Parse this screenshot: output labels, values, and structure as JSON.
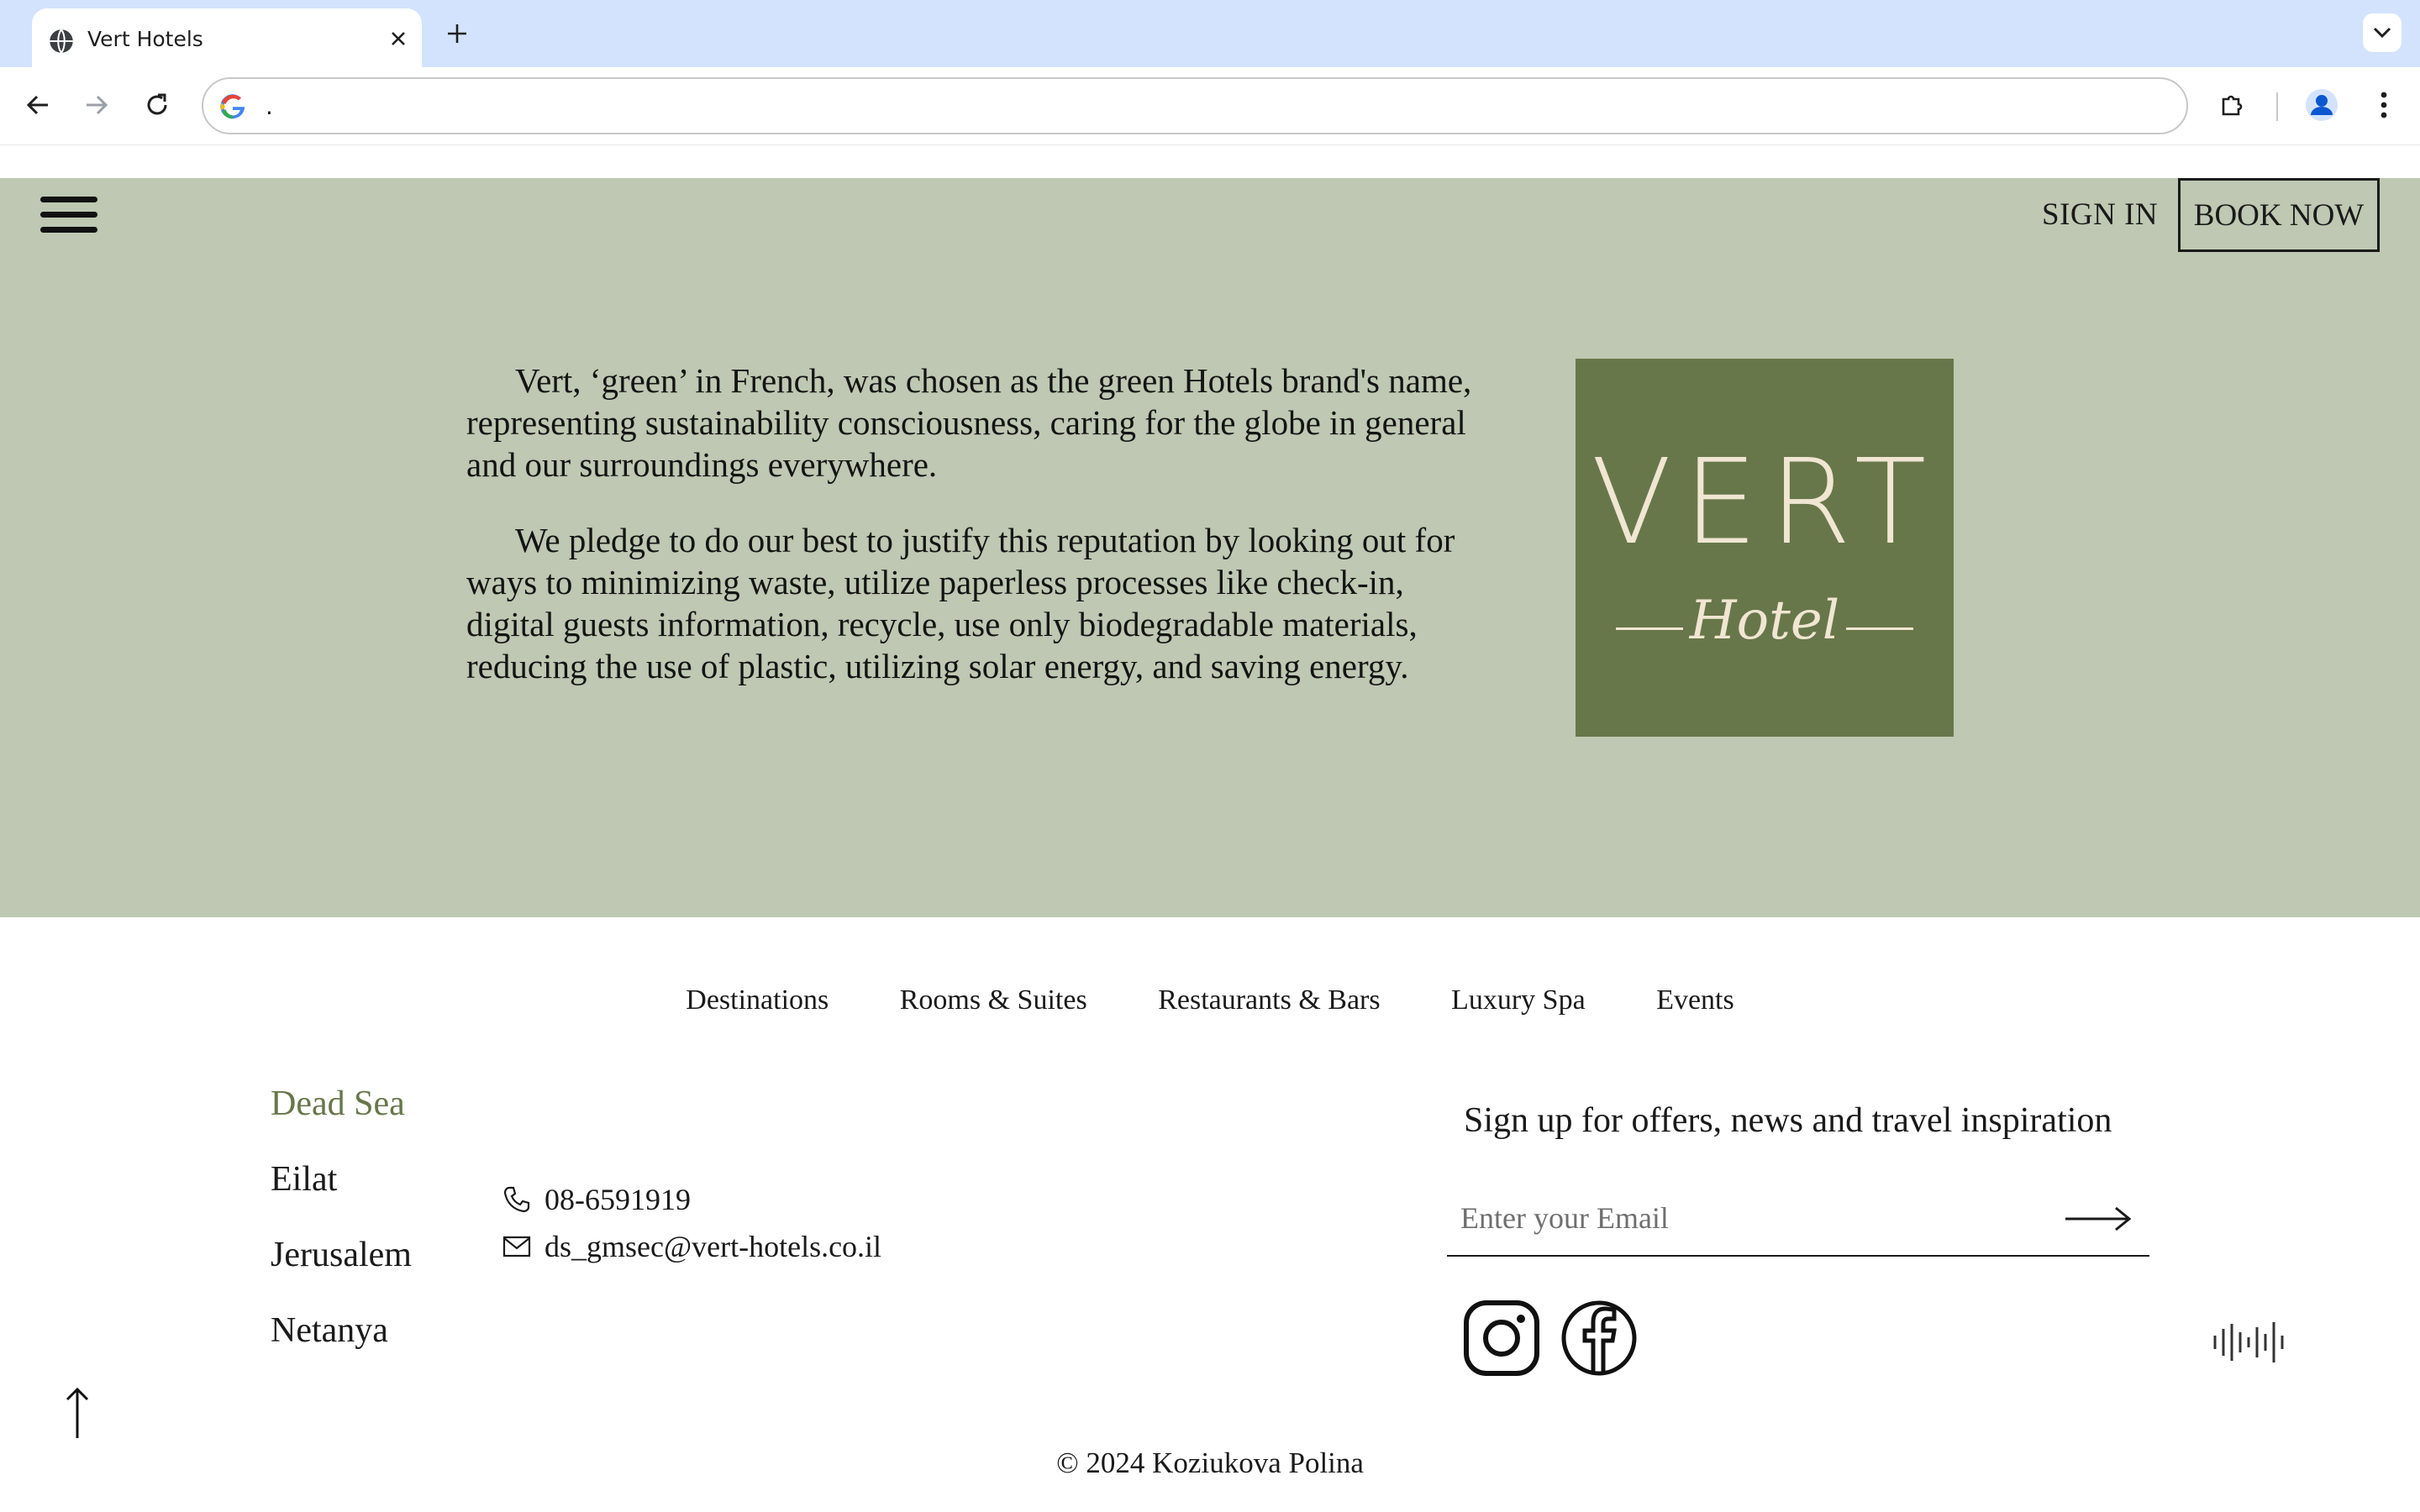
{
  "browser": {
    "tab_title": "Vert Hotels",
    "address_text": ".",
    "icons": {
      "favicon": "globe-icon",
      "close": "close-icon",
      "new_tab": "plus-icon",
      "tab_list": "chevron-down-icon",
      "back": "back-arrow-icon",
      "forward": "forward-arrow-icon",
      "reload": "reload-icon",
      "google": "google-g-icon",
      "extensions": "puzzle-icon",
      "profile": "profile-avatar-icon",
      "menu": "kebab-menu-icon"
    }
  },
  "header": {
    "menu_icon": "hamburger-icon",
    "sign_in_label": "SIGN IN",
    "book_now_label": "BOOK NOW"
  },
  "hero": {
    "paragraphs": [
      "Vert, ‘green’ in French, was chosen as the green Hotels brand's name, representing sustainability consciousness, caring for the globe in general and our surroundings everywhere.",
      "We pledge to do our best to justify this reputation by looking out for ways to minimizing waste, utilize paperless processes like check-in, digital guests information, recycle, use only biodegradable materials, reducing the use of plastic, utilizing solar energy, and saving energy."
    ],
    "logo": {
      "word": "VERT",
      "script": "Hotel",
      "bg_color": "#67774a",
      "fg_color": "#f0e6d2"
    },
    "bg_color": "#bec8b2"
  },
  "footer": {
    "nav": [
      "Destinations",
      "Rooms & Suites",
      "Restaurants & Bars",
      "Luxury Spa",
      "Events"
    ],
    "destinations": [
      {
        "label": "Dead Sea",
        "active": true
      },
      {
        "label": "Eilat",
        "active": false
      },
      {
        "label": "Jerusalem",
        "active": false
      },
      {
        "label": "Netanya",
        "active": false
      }
    ],
    "contact": {
      "phone": "08-6591919",
      "email": "ds_gmsec@vert-hotels.co.il",
      "phone_icon": "phone-icon",
      "email_icon": "mail-icon"
    },
    "signup": {
      "title": "Sign up for offers, news and travel inspiration",
      "placeholder": "Enter your Email",
      "submit_icon": "arrow-right-icon"
    },
    "social": [
      "instagram-icon",
      "facebook-icon"
    ],
    "audio_icon": "audio-wave-icon",
    "back_to_top_icon": "arrow-up-icon",
    "copyright": "© 2024 Koziukova Polina",
    "accent_color": "#67774a"
  }
}
